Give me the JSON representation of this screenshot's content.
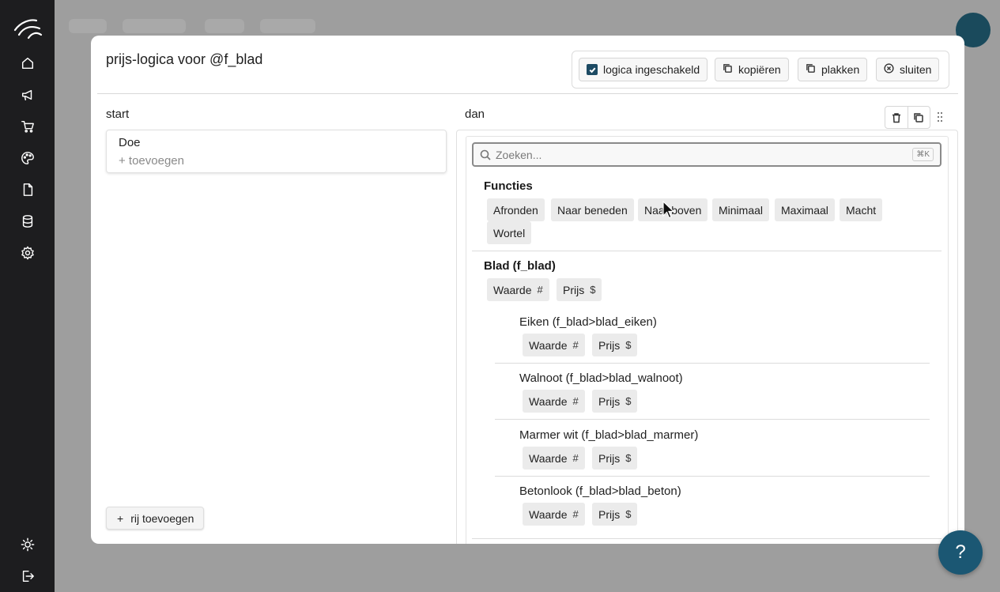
{
  "sidebar": {
    "icons": [
      "logo-icon",
      "home-icon",
      "megaphone-icon",
      "cart-icon",
      "palette-icon",
      "document-icon",
      "database-icon",
      "settings-icon"
    ],
    "bottom_icons": [
      "sun-icon",
      "logout-icon"
    ]
  },
  "modal": {
    "title": "prijs-logica voor @f_blad",
    "toolbar": {
      "toggle_label": "logica ingeschakeld",
      "toggle_checked": true,
      "copy_label": "kopiëren",
      "paste_label": "plakken",
      "close_label": "sluiten"
    },
    "start": {
      "label": "start",
      "card_title": "Doe",
      "card_add": "+ toevoegen",
      "add_row_plus": "+",
      "add_row_label": "rij toevoegen"
    },
    "then": {
      "label": "dan"
    },
    "picker": {
      "search_placeholder": "Zoeken...",
      "shortcut": "⌘K",
      "functions": {
        "title": "Functies",
        "items": [
          "Afronden",
          "Naar beneden",
          "Naar boven",
          "Minimaal",
          "Maximaal",
          "Macht",
          "Wortel"
        ]
      },
      "blad": {
        "title": "Blad (f_blad)",
        "chips": [
          {
            "label": "Waarde",
            "symbol": "#"
          },
          {
            "label": "Prijs",
            "symbol": "$"
          }
        ],
        "children": [
          {
            "title": "Eiken (f_blad>blad_eiken)",
            "chips": [
              {
                "label": "Waarde",
                "symbol": "#"
              },
              {
                "label": "Prijs",
                "symbol": "$"
              }
            ]
          },
          {
            "title": "Walnoot (f_blad>blad_walnoot)",
            "chips": [
              {
                "label": "Waarde",
                "symbol": "#"
              },
              {
                "label": "Prijs",
                "symbol": "$"
              }
            ]
          },
          {
            "title": "Marmer wit (f_blad>blad_marmer)",
            "chips": [
              {
                "label": "Waarde",
                "symbol": "#"
              },
              {
                "label": "Prijs",
                "symbol": "$"
              }
            ]
          },
          {
            "title": "Betonlook (f_blad>blad_beton)",
            "chips": [
              {
                "label": "Waarde",
                "symbol": "#"
              },
              {
                "label": "Prijs",
                "symbol": "$"
              }
            ]
          }
        ]
      }
    }
  },
  "help": {
    "label": "?"
  },
  "colors": {
    "sidebar_bg": "#1d1d1f",
    "accent": "#1b5773",
    "chip_bg": "#ebebeb"
  }
}
